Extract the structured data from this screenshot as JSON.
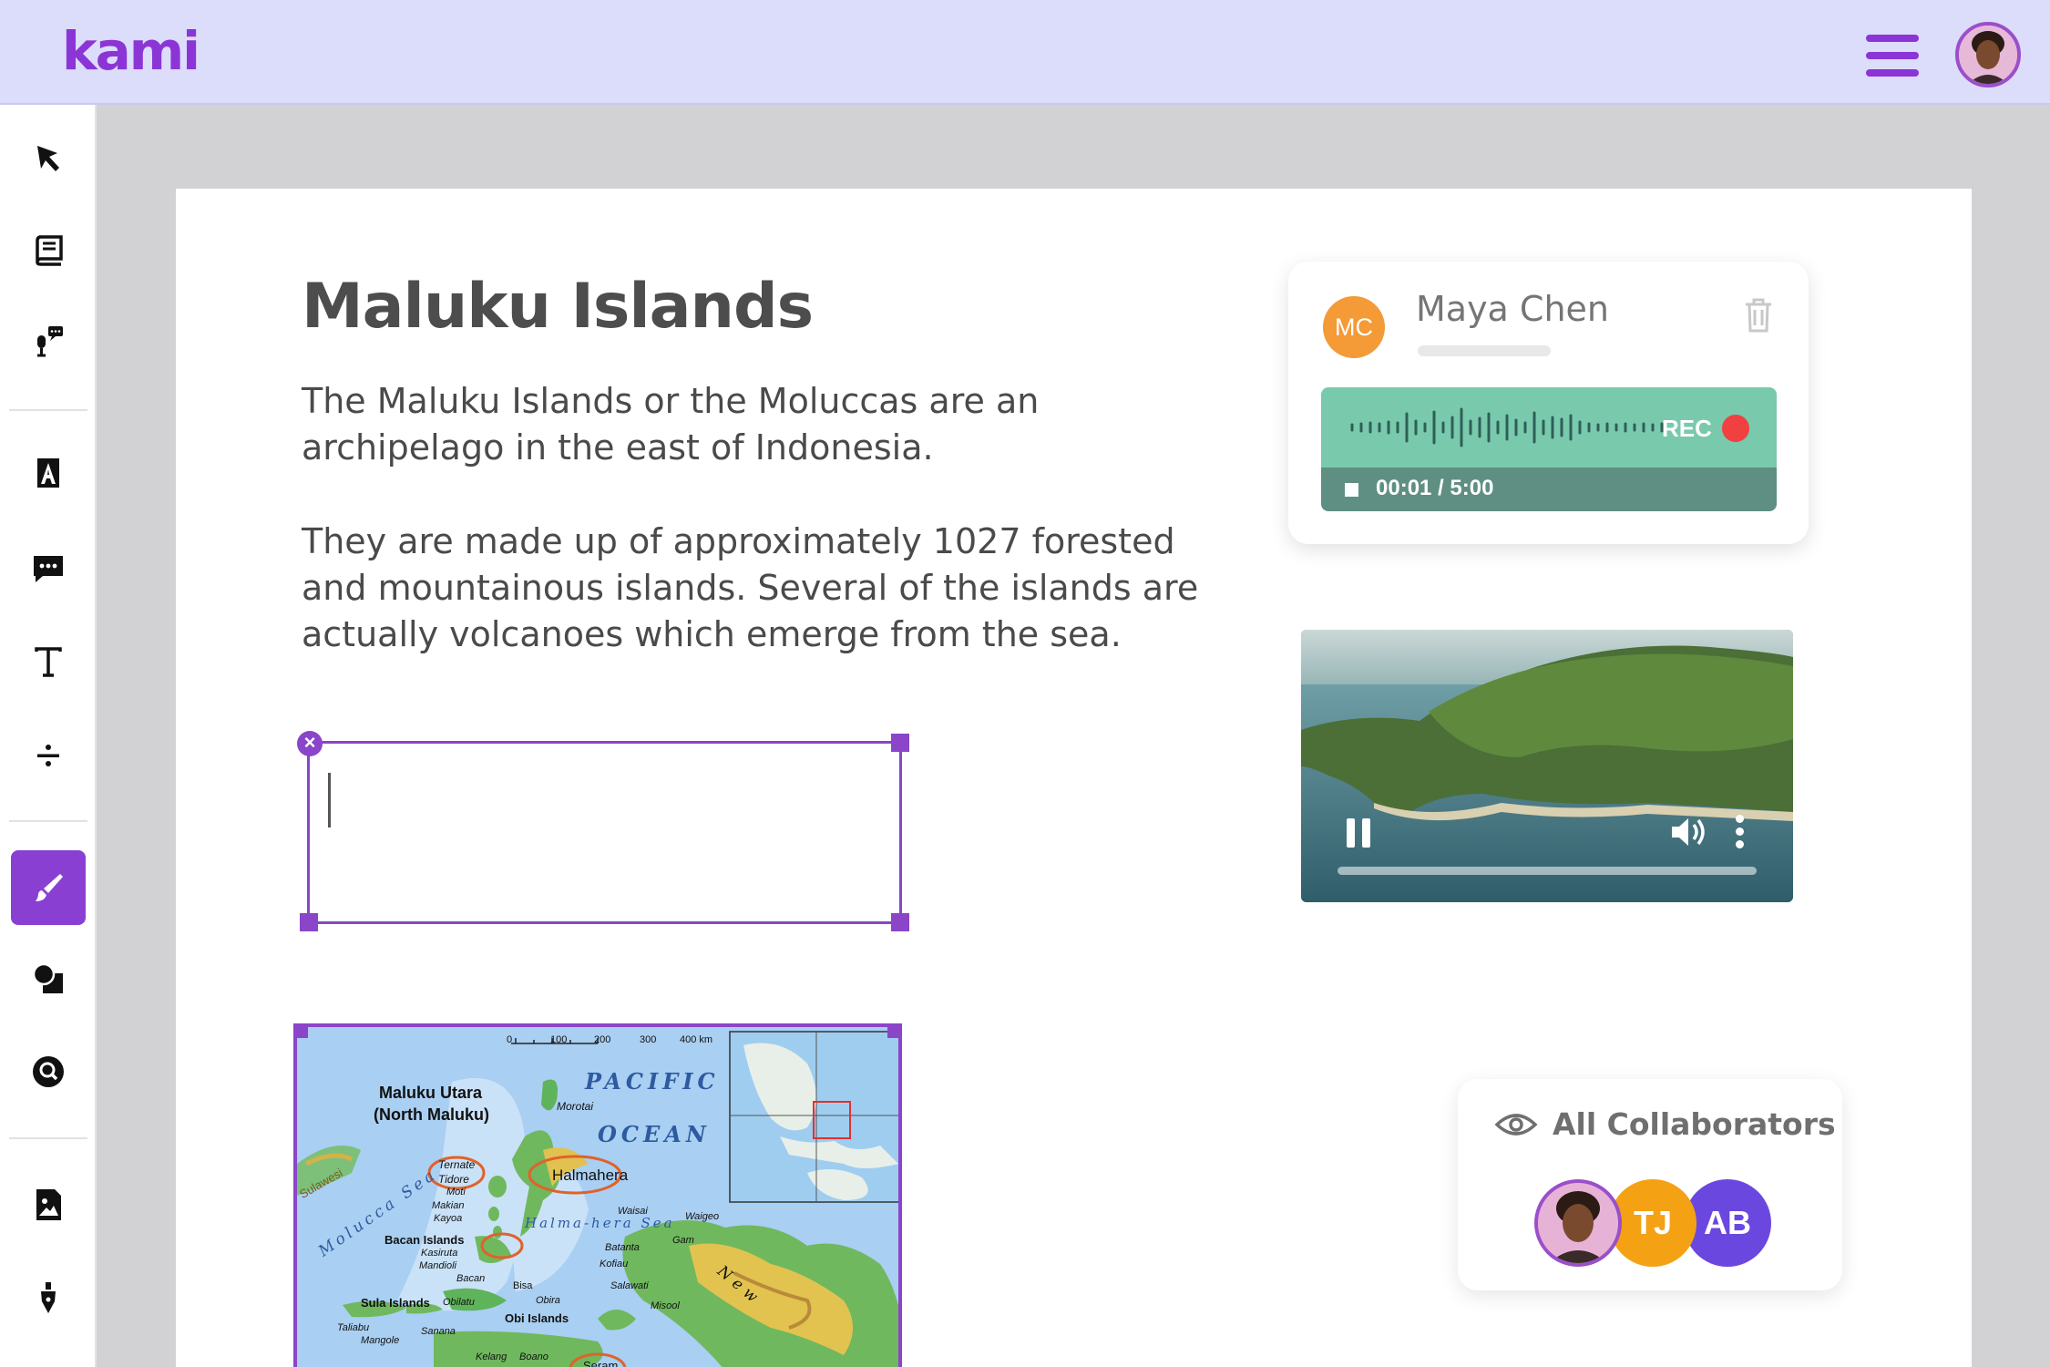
{
  "app": {
    "logo": "kami"
  },
  "header": {
    "menu_icon": "hamburger-menu-icon",
    "avatar_icon": "user-avatar"
  },
  "toolbar": {
    "items": [
      {
        "name": "select-tool",
        "icon": "cursor-arrow-icon"
      },
      {
        "name": "dictionary-tool",
        "icon": "book-icon"
      },
      {
        "name": "read-aloud-tool",
        "icon": "microphone-speech-icon"
      },
      {
        "name": "markup-tool",
        "icon": "highlighter-icon"
      },
      {
        "name": "comment-tool",
        "icon": "comment-icon"
      },
      {
        "name": "text-tool",
        "icon": "text-icon"
      },
      {
        "name": "equation-tool",
        "icon": "divide-icon"
      },
      {
        "name": "drawing-tool",
        "icon": "paintbrush-icon",
        "active": true
      },
      {
        "name": "shapes-tool",
        "icon": "shapes-icon"
      },
      {
        "name": "eraser-tool",
        "icon": "search-bubble-icon"
      },
      {
        "name": "add-media-tool",
        "icon": "image-icon"
      },
      {
        "name": "signature-tool",
        "icon": "pen-nib-icon"
      }
    ]
  },
  "document": {
    "title": "Maluku Islands",
    "para1": "The Maluku Islands or the Moluccas are an archipelago in the east of Indonesia.",
    "para2": "They are made up of approximately 1027 forested and mountainous islands. Several of the islands are actually volcanoes which emerge from the sea."
  },
  "map": {
    "scale_labels": [
      "0",
      "100",
      "200",
      "300",
      "400 km"
    ],
    "ocean_line1": "PACIFIC",
    "ocean_line2": "OCEAN",
    "labels": {
      "north_maluku_1": "Maluku Utara",
      "north_maluku_2": "(North Maluku)",
      "morotai": "Morotai",
      "ternate": "Ternate",
      "tidore": "Tidore",
      "moti": "Moti",
      "makian": "Makian",
      "kayoa": "Kayoa",
      "halmahera": "Halmahera",
      "halmahera_sea": "Halma-hera Sea",
      "molucca_sea": "Molucca Sea",
      "sulawesi": "Sulawesi",
      "bacan_islands": "Bacan Islands",
      "kasiruta": "Kasiruta",
      "mandioli": "Mandioli",
      "bacan": "Bacan",
      "bisa": "Bisa",
      "obira": "Obira",
      "obi_islands": "Obi Islands",
      "sula_islands": "Sula Islands",
      "obilatu": "Obilatu",
      "taliabu": "Taliabu",
      "mangole": "Mangole",
      "sanana": "Sanana",
      "kelang": "Kelang",
      "boano": "Boano",
      "seram": "Seram",
      "waisai": "Waisai",
      "waigeo": "Waigeo",
      "gam": "Gam",
      "batanta": "Batanta",
      "kofiau": "Kofiau",
      "salawati": "Salawati",
      "misool": "Misool",
      "new": "New"
    }
  },
  "audio": {
    "initials": "MC",
    "name": "Maya Chen",
    "rec_label": "REC",
    "time": "00:01 / 5:00",
    "colors": {
      "wave": "#79c9ad",
      "controls": "#5f8f82",
      "rec": "#f04040"
    }
  },
  "video": {
    "progress": 0.0
  },
  "collaborators": {
    "title": "All Collaborators",
    "people": [
      {
        "initials": "",
        "color": "#c98bd6",
        "kind": "photo"
      },
      {
        "initials": "TJ",
        "color": "#f5a114"
      },
      {
        "initials": "AB",
        "color": "#6a48df"
      }
    ]
  },
  "colors": {
    "brand": "#8b35d6",
    "topbar": "#dcdcfb",
    "selection": "#8a45c9"
  }
}
